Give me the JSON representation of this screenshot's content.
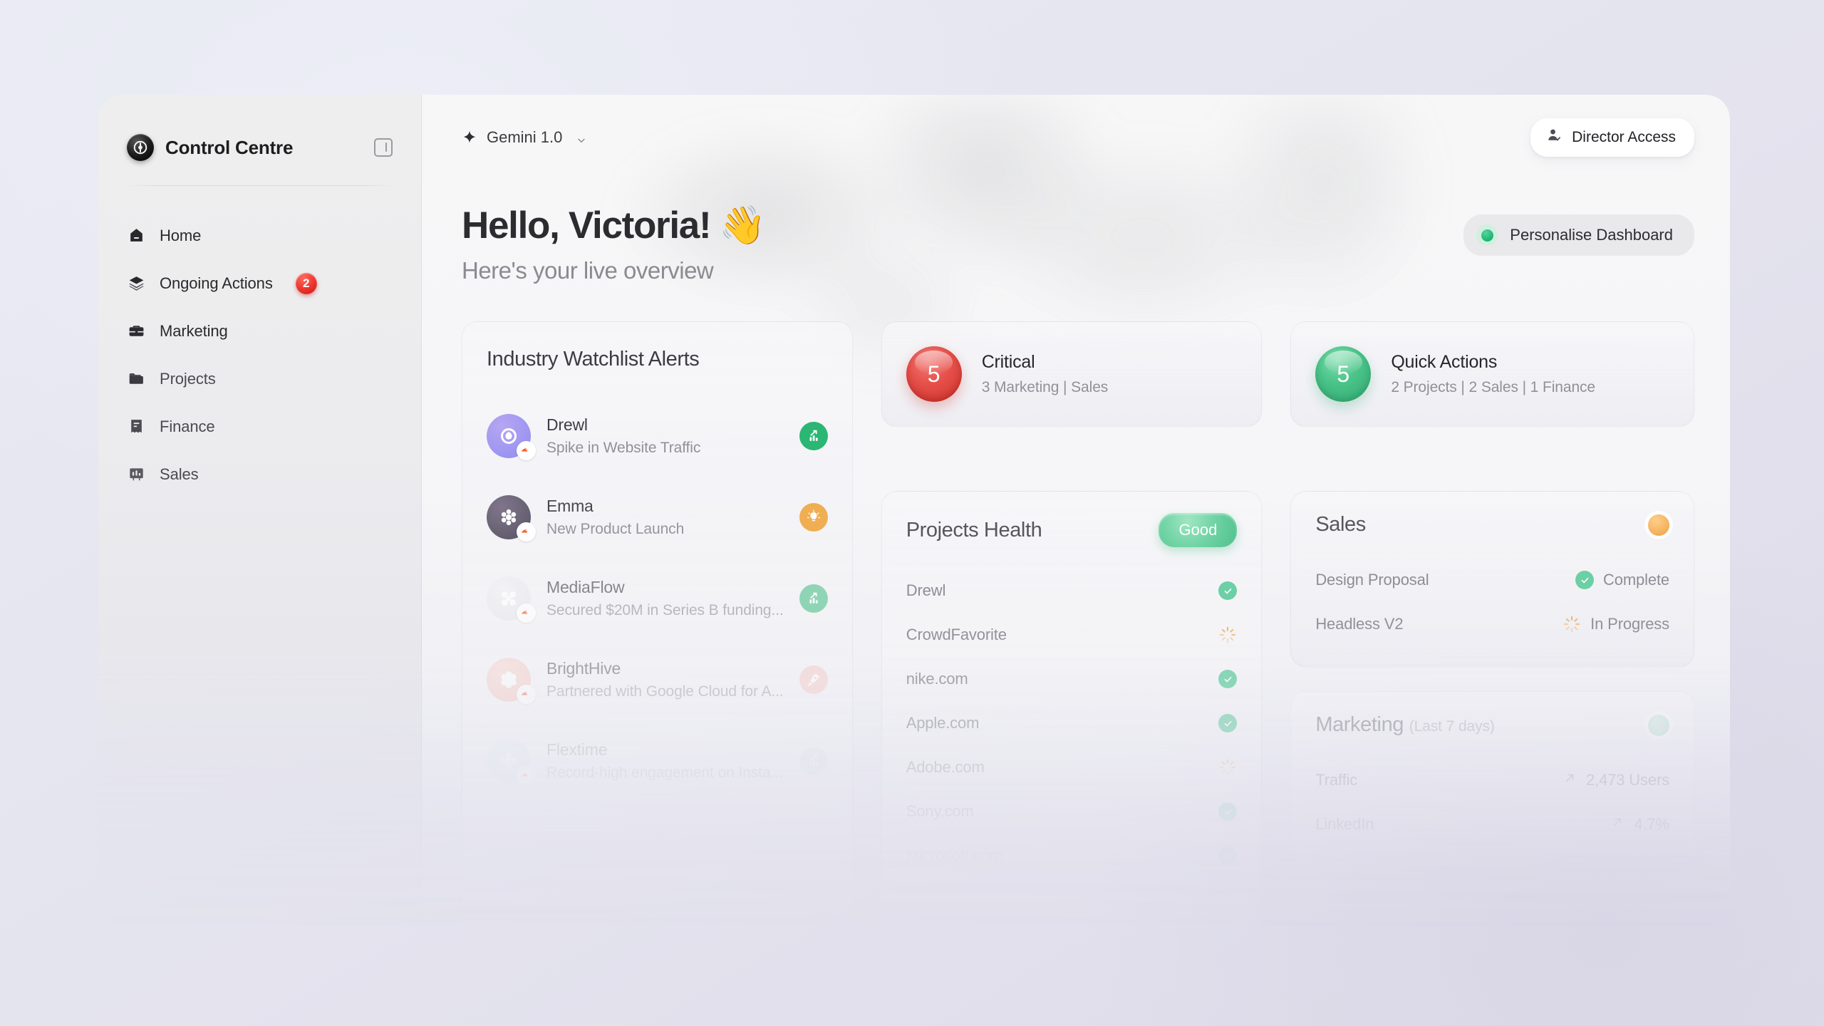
{
  "sidebar": {
    "brand": "Control Centre",
    "collapse_icon": "panel-collapse-icon",
    "items": [
      {
        "label": "Home",
        "icon": "home-icon"
      },
      {
        "label": "Ongoing Actions",
        "icon": "layers-icon",
        "badge": "2"
      },
      {
        "label": "Marketing",
        "icon": "briefcase-icon"
      },
      {
        "label": "Projects",
        "icon": "folder-icon"
      },
      {
        "label": "Finance",
        "icon": "receipt-icon"
      },
      {
        "label": "Sales",
        "icon": "chart-icon"
      }
    ]
  },
  "topbar": {
    "model": "Gemini 1.0",
    "model_icon": "sparkle-icon",
    "model_chevron": "chevron-down-icon",
    "director_label": "Director Access",
    "director_icon": "user-check-icon"
  },
  "hero": {
    "greeting": "Hello, Victoria!",
    "wave": "👋",
    "subtitle": "Here's your live overview",
    "personalise_label": "Personalise Dashboard"
  },
  "stats": [
    {
      "count": "5",
      "title": "Critical",
      "subtitle": "3 Marketing | Sales",
      "color": "#cf322c"
    },
    {
      "count": "5",
      "title": "Quick Actions",
      "subtitle": "2 Projects | 2 Sales | 1 Finance",
      "color": "#33ab74"
    }
  ],
  "projects_health": {
    "title": "Projects Health",
    "status_label": "Good",
    "rows": [
      {
        "name": "Drewl",
        "status": "complete"
      },
      {
        "name": "CrowdFavorite",
        "status": "progress"
      },
      {
        "name": "nike.com",
        "status": "complete"
      },
      {
        "name": "Apple.com",
        "status": "complete"
      },
      {
        "name": "Adobe.com",
        "status": "progress"
      },
      {
        "name": "Sony.com",
        "status": "complete"
      },
      {
        "name": "Microsoft.com",
        "status": "complete"
      }
    ]
  },
  "sales": {
    "title": "Sales",
    "status_color": "#f5b45f",
    "rows": [
      {
        "name": "Design Proposal",
        "value": "Complete",
        "status": "complete"
      },
      {
        "name": "Headless V2",
        "value": "In Progress",
        "status": "progress"
      }
    ]
  },
  "marketing": {
    "title": "Marketing",
    "title_suffix": "(Last 7 days)",
    "status_color": "#b5e3cd",
    "rows": [
      {
        "name": "Traffic",
        "value": "2,473 Users",
        "trend": "up"
      },
      {
        "name": "LinkedIn",
        "value": "4.7%",
        "trend": "up"
      }
    ]
  },
  "alerts": {
    "title": "Industry Watchlist Alerts",
    "items": [
      {
        "name": "Drewl",
        "desc": "Spike in Website Traffic",
        "tag": "growth-icon",
        "tag_class": "tag-green",
        "avatar_from": "#8f8df0",
        "avatar_to": "#b7a6f2"
      },
      {
        "name": "Emma",
        "desc": "New Product Launch",
        "tag": "idea-icon",
        "tag_class": "tag-amber",
        "avatar_from": "#5d5a68",
        "avatar_to": "#7b6f86"
      },
      {
        "name": "MediaFlow",
        "desc": "Secured $20M in Series B funding...",
        "tag": "growth-icon",
        "tag_class": "tag-greenL",
        "avatar_from": "#e6e6ea",
        "avatar_to": "#efeff3"
      },
      {
        "name": "BrightHive",
        "desc": "Partnered with Google Cloud for A...",
        "tag": "rocket-icon",
        "tag_class": "tag-rose",
        "avatar_from": "#f6c3ba",
        "avatar_to": "#f9d3cc"
      },
      {
        "name": "Flextime",
        "desc": "Record-high engagement on Insta...",
        "tag": "growth-icon",
        "tag_class": "tag-mint",
        "avatar_from": "#cfe6ee",
        "avatar_to": "#dfeef3"
      }
    ]
  }
}
